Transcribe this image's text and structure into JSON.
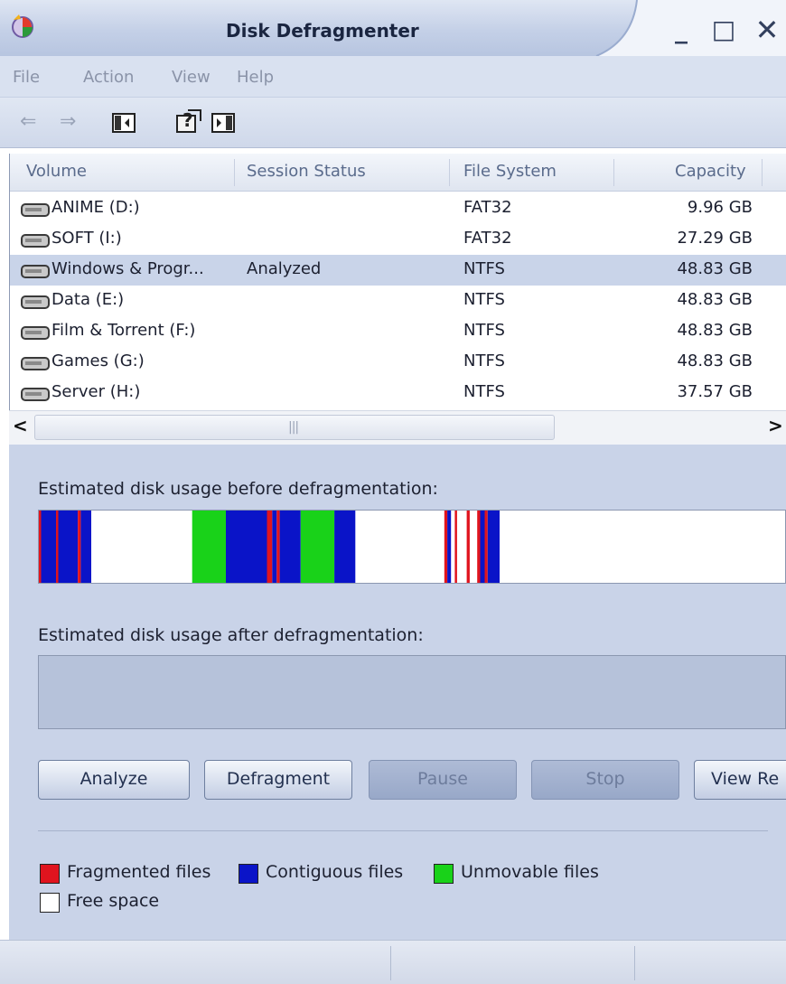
{
  "window": {
    "title": "Disk Defragmenter",
    "controls": {
      "minimize": "_",
      "maximize": "□",
      "close": "✕"
    }
  },
  "menu": [
    "File",
    "Action",
    "View",
    "Help"
  ],
  "toolbar": {
    "icons": [
      "back-arrow-icon",
      "forward-arrow-icon",
      "console-tree-icon",
      "help-icon",
      "action-pane-icon"
    ],
    "back": "⇐",
    "forward": "⇒"
  },
  "volume_list": {
    "columns": [
      "Volume",
      "Session Status",
      "File System",
      "Capacity"
    ],
    "rows": [
      {
        "volume": "ANIME (D:)",
        "status": "",
        "fs": "FAT32",
        "capacity": "9.96 GB",
        "selected": false
      },
      {
        "volume": "SOFT (I:)",
        "status": "",
        "fs": "FAT32",
        "capacity": "27.29 GB",
        "selected": false
      },
      {
        "volume": "Windows & Progr...",
        "status": "Analyzed",
        "fs": "NTFS",
        "capacity": "48.83 GB",
        "selected": true
      },
      {
        "volume": "Data (E:)",
        "status": "",
        "fs": "NTFS",
        "capacity": "48.83 GB",
        "selected": false
      },
      {
        "volume": "Film & Torrent (F:)",
        "status": "",
        "fs": "NTFS",
        "capacity": "48.83 GB",
        "selected": false
      },
      {
        "volume": "Games (G:)",
        "status": "",
        "fs": "NTFS",
        "capacity": "48.83 GB",
        "selected": false
      },
      {
        "volume": "Server (H:)",
        "status": "",
        "fs": "NTFS",
        "capacity": "37.57 GB",
        "selected": false
      }
    ],
    "scroll_left": "<",
    "scroll_right": ">",
    "scroll_grip": "|||"
  },
  "before": {
    "label": "Estimated disk usage before defragmentation:",
    "segments": [
      {
        "type": "fragmented",
        "from": 0.0,
        "to": 0.003
      },
      {
        "type": "contiguous",
        "from": 0.003,
        "to": 0.023
      },
      {
        "type": "fragmented",
        "from": 0.023,
        "to": 0.026
      },
      {
        "type": "contiguous",
        "from": 0.026,
        "to": 0.052
      },
      {
        "type": "fragmented",
        "from": 0.052,
        "to": 0.056
      },
      {
        "type": "contiguous",
        "from": 0.056,
        "to": 0.07
      },
      {
        "type": "unmovable",
        "from": 0.205,
        "to": 0.25
      },
      {
        "type": "contiguous",
        "from": 0.25,
        "to": 0.305
      },
      {
        "type": "fragmented",
        "from": 0.305,
        "to": 0.312
      },
      {
        "type": "contiguous",
        "from": 0.312,
        "to": 0.318
      },
      {
        "type": "fragmented",
        "from": 0.318,
        "to": 0.322
      },
      {
        "type": "contiguous",
        "from": 0.322,
        "to": 0.35
      },
      {
        "type": "unmovable",
        "from": 0.35,
        "to": 0.395
      },
      {
        "type": "contiguous",
        "from": 0.395,
        "to": 0.423
      },
      {
        "type": "fragmented",
        "from": 0.542,
        "to": 0.546
      },
      {
        "type": "contiguous",
        "from": 0.546,
        "to": 0.551
      },
      {
        "type": "fragmented",
        "from": 0.556,
        "to": 0.559
      },
      {
        "type": "fragmented",
        "from": 0.572,
        "to": 0.576
      },
      {
        "type": "fragmented",
        "from": 0.586,
        "to": 0.59
      },
      {
        "type": "contiguous",
        "from": 0.59,
        "to": 0.596
      },
      {
        "type": "fragmented",
        "from": 0.596,
        "to": 0.6
      },
      {
        "type": "contiguous",
        "from": 0.6,
        "to": 0.616
      }
    ]
  },
  "after": {
    "label": "Estimated disk usage after defragmentation:"
  },
  "buttons": {
    "analyze": "Analyze",
    "defragment": "Defragment",
    "pause": "Pause",
    "stop": "Stop",
    "view_report": "View Re"
  },
  "legend": {
    "fragmented": "Fragmented files",
    "contiguous": "Contiguous files",
    "unmovable": "Unmovable files",
    "free": "Free space"
  },
  "colors": {
    "fragmented": "#e0141e",
    "contiguous": "#0a14c8",
    "unmovable": "#19d219",
    "free": "#ffffff"
  }
}
